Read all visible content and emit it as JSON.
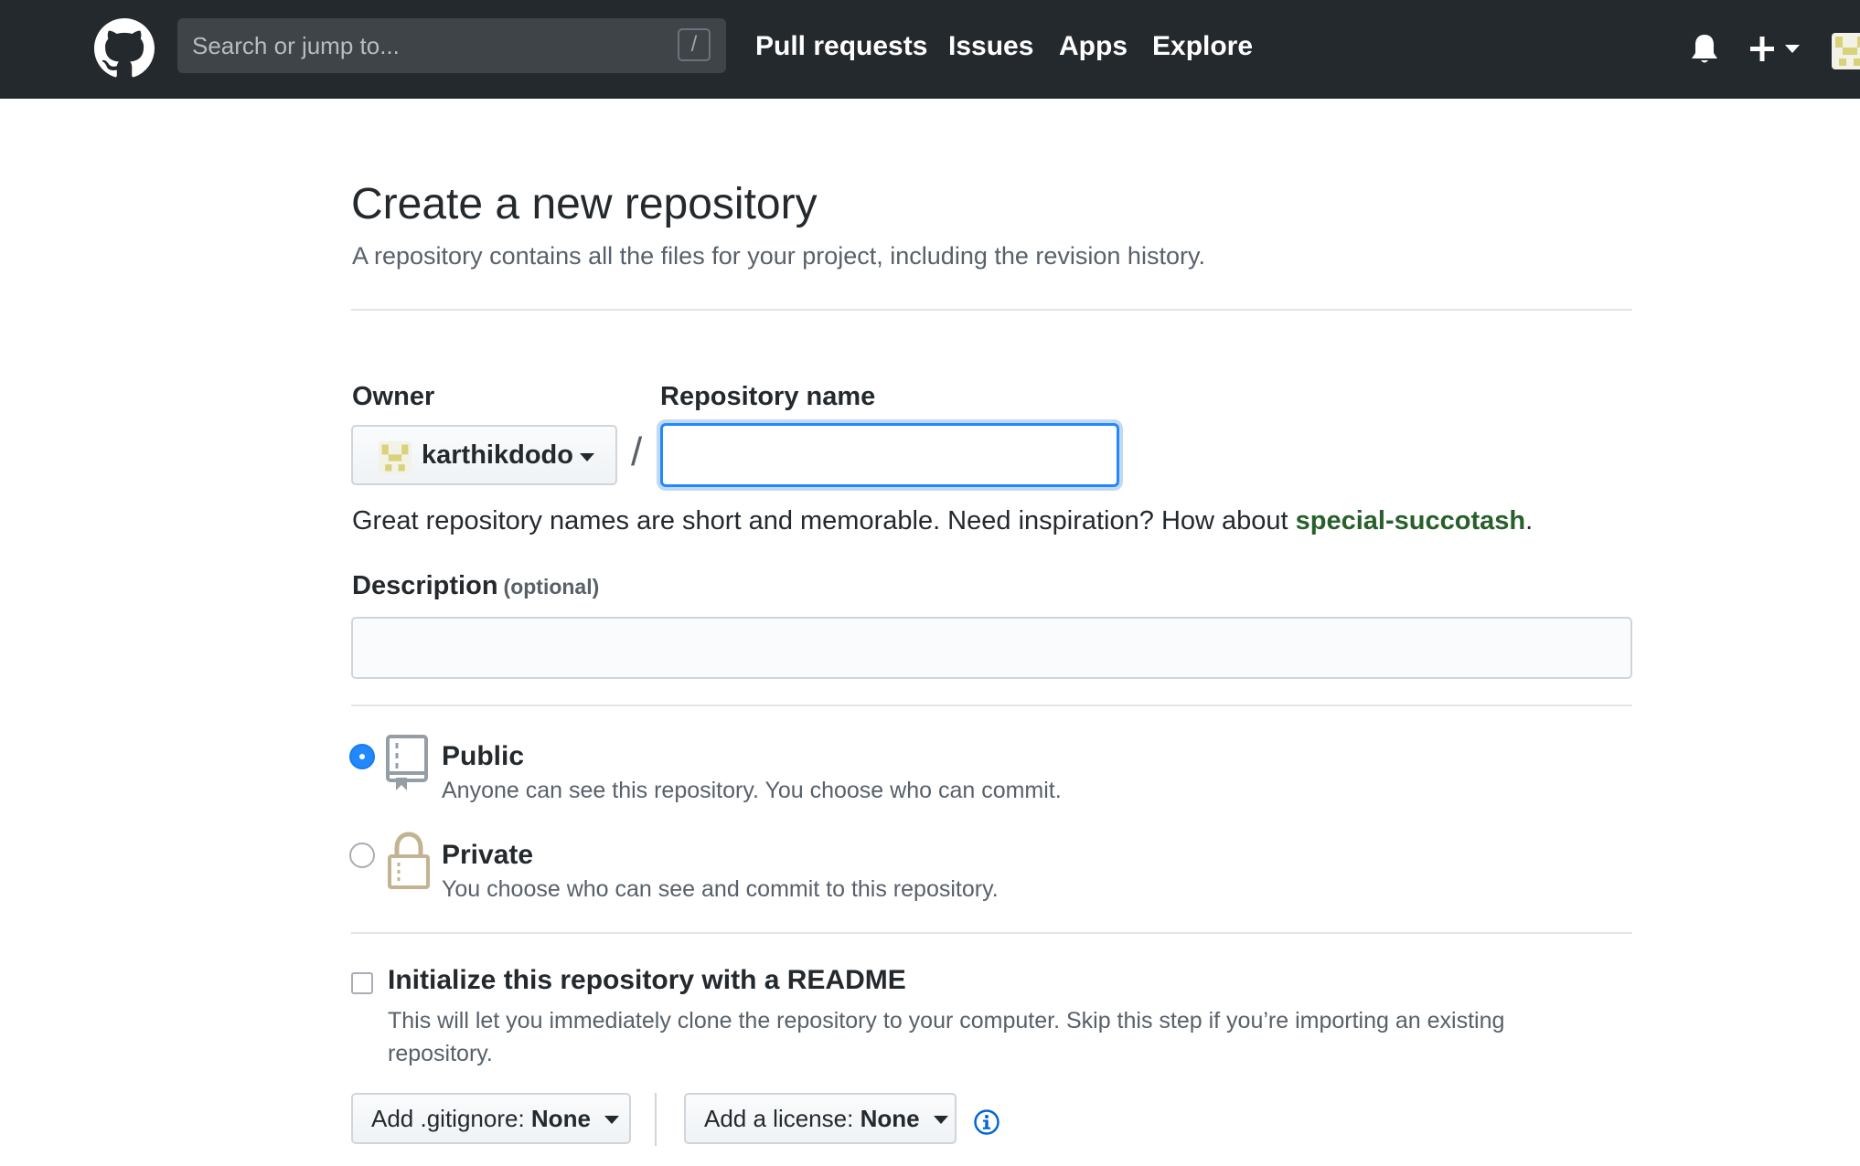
{
  "header": {
    "search_placeholder": "Search or jump to...",
    "search_shortcut": "/",
    "nav": [
      "Pull requests",
      "Issues",
      "Apps",
      "Explore"
    ]
  },
  "page": {
    "title": "Create a new repository",
    "subtitle": "A repository contains all the files for your project, including the revision history."
  },
  "form": {
    "owner_label": "Owner",
    "owner_value": "karthikdodo",
    "separator": "/",
    "repo_label": "Repository name",
    "repo_value": "",
    "hint_prefix": "Great repository names are short and memorable. Need inspiration? How about ",
    "hint_suggestion": "special-succotash",
    "hint_suffix": ".",
    "description_label": "Description",
    "description_optional": "(optional)",
    "description_value": ""
  },
  "visibility": {
    "selected": "public",
    "public_title": "Public",
    "public_desc": "Anyone can see this repository. You choose who can commit.",
    "private_title": "Private",
    "private_desc": "You choose who can see and commit to this repository."
  },
  "init": {
    "readme_checked": false,
    "readme_title": "Initialize this repository with a README",
    "readme_desc": "This will let you immediately clone the repository to your computer. Skip this step if you’re importing an existing repository.",
    "gitignore_label": "Add .gitignore:",
    "gitignore_value": "None",
    "license_label": "Add a license:",
    "license_value": "None"
  },
  "icons": {
    "logo": "github-octocat-icon",
    "notifications": "bell-icon",
    "create": "plus-icon",
    "public": "repo-book-icon",
    "private": "lock-icon",
    "info": "info-icon"
  },
  "colors": {
    "header_bg": "#24292e",
    "accent_blue": "#2188ff",
    "suggestion_green": "#28602b"
  }
}
